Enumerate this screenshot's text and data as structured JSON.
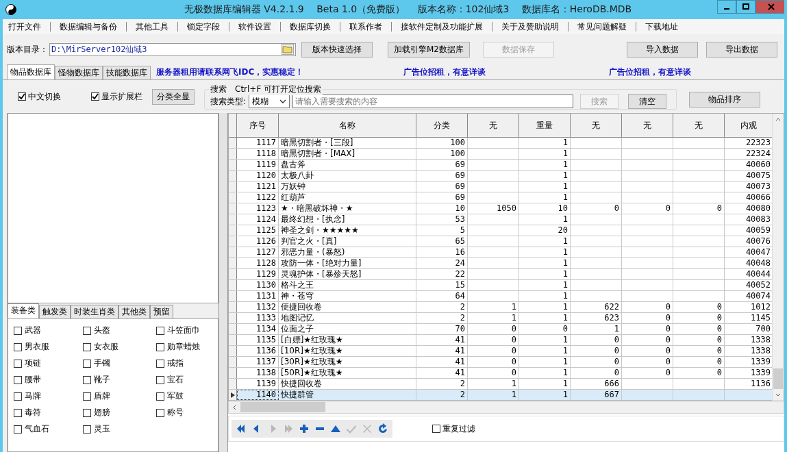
{
  "window": {
    "title": "无极数据库编辑器 V4.2.1.9　 Beta 1.0（免费版）　 版本名称：102仙域3　 数据库名：HeroDB.MDB"
  },
  "menu": [
    "打开文件",
    "数据编辑与备份",
    "其他工具",
    "锁定字段",
    "软件设置",
    "数据库切换",
    "联系作者",
    "接软件定制及功能扩展",
    "关于及赞助说明",
    "常见问题解疑",
    "下载地址"
  ],
  "toolbar": {
    "dir_label": "版本目录：",
    "dir_value": "D:\\MirServer102仙域3",
    "buttons": [
      {
        "label": "版本快速选择",
        "disabled": false
      },
      {
        "label": "加载引擎M2数据库",
        "disabled": false
      },
      {
        "label": "数据保存",
        "disabled": true
      },
      {
        "label": "导入数据",
        "disabled": false
      },
      {
        "label": "导出数据",
        "disabled": false
      }
    ]
  },
  "tabs": [
    {
      "label": "物品数据库",
      "selected": true
    },
    {
      "label": "怪物数据库",
      "selected": false
    },
    {
      "label": "技能数据库",
      "selected": false
    }
  ],
  "ads": [
    "服务器租用请联系网飞IDC，实惠稳定！",
    "广告位招租，有意详谈",
    "广告位招租，有意详谈"
  ],
  "options": [
    {
      "label": "中文切换",
      "checked": true
    },
    {
      "label": "显示扩展栏",
      "checked": true
    }
  ],
  "show_all_button": "分类全显",
  "search": {
    "title": "搜索　Ctrl+F 可打开定位搜索",
    "type_label": "搜索类型:",
    "type_value": "模糊",
    "placeholder": "请输入需要搜索的内容",
    "search_button": {
      "label": "搜索",
      "disabled": true
    },
    "clear_button": "清空"
  },
  "sort_button": "物品排序",
  "category_tabs": [
    {
      "label": "装备类",
      "selected": true
    },
    {
      "label": "触发类",
      "selected": false
    },
    {
      "label": "时装生肖类",
      "selected": false
    },
    {
      "label": "其他类",
      "selected": false
    },
    {
      "label": "预留",
      "selected": false
    }
  ],
  "categories": [
    {
      "label": "武器",
      "checked": false
    },
    {
      "label": "头盔",
      "checked": false
    },
    {
      "label": "斗笠面巾",
      "checked": false
    },
    {
      "label": "男衣服",
      "checked": false
    },
    {
      "label": "女衣服",
      "checked": false
    },
    {
      "label": "勋章蜡烛",
      "checked": false
    },
    {
      "label": "项链",
      "checked": false
    },
    {
      "label": "手镯",
      "checked": false
    },
    {
      "label": "戒指",
      "checked": false
    },
    {
      "label": "腰带",
      "checked": false
    },
    {
      "label": "靴子",
      "checked": false
    },
    {
      "label": "宝石",
      "checked": false
    },
    {
      "label": "马牌",
      "checked": false
    },
    {
      "label": "盾牌",
      "checked": false
    },
    {
      "label": "军鼓",
      "checked": false
    },
    {
      "label": "毒符",
      "checked": false
    },
    {
      "label": "翅膀",
      "checked": false
    },
    {
      "label": "称号",
      "checked": false
    },
    {
      "label": "气血石",
      "checked": false
    },
    {
      "label": "灵玉",
      "checked": false
    }
  ],
  "table": {
    "columns": [
      "序号",
      "名称",
      "分类",
      "无",
      "重量",
      "无",
      "无",
      "无",
      "内观"
    ],
    "rows": [
      {
        "cells": [
          "1117",
          "暗黑切割者・[三段]",
          "100",
          "",
          "1",
          "",
          "",
          "",
          "22323"
        ],
        "selected": false
      },
      {
        "cells": [
          "1118",
          "暗黑切割者・[MAX]",
          "100",
          "",
          "1",
          "",
          "",
          "",
          "22324"
        ],
        "selected": false
      },
      {
        "cells": [
          "1119",
          "盘古斧",
          "69",
          "",
          "1",
          "",
          "",
          "",
          "40060"
        ],
        "selected": false
      },
      {
        "cells": [
          "1120",
          "太极八卦",
          "69",
          "",
          "1",
          "",
          "",
          "",
          "40075"
        ],
        "selected": false
      },
      {
        "cells": [
          "1121",
          "万妖钟",
          "69",
          "",
          "1",
          "",
          "",
          "",
          "40073"
        ],
        "selected": false
      },
      {
        "cells": [
          "1122",
          "红葫芦",
          "69",
          "",
          "1",
          "",
          "",
          "",
          "40066"
        ],
        "selected": false
      },
      {
        "cells": [
          "1123",
          "★・暗黑破坏神・★",
          "10",
          "1050",
          "10",
          "0",
          "0",
          "0",
          "40080"
        ],
        "selected": false
      },
      {
        "cells": [
          "1124",
          "最终幻想・[执念]",
          "53",
          "",
          "1",
          "",
          "",
          "",
          "40083"
        ],
        "selected": false
      },
      {
        "cells": [
          "1125",
          "神圣之剑・★★★★★",
          "5",
          "",
          "20",
          "",
          "",
          "",
          "40059"
        ],
        "selected": false
      },
      {
        "cells": [
          "1126",
          "判官之火・[真]",
          "65",
          "",
          "1",
          "",
          "",
          "",
          "40076"
        ],
        "selected": false
      },
      {
        "cells": [
          "1127",
          "邪恶力量・(暴怒)",
          "16",
          "",
          "1",
          "",
          "",
          "",
          "40047"
        ],
        "selected": false
      },
      {
        "cells": [
          "1128",
          "攻防一体・[绝对力量]",
          "24",
          "",
          "1",
          "",
          "",
          "",
          "40048"
        ],
        "selected": false
      },
      {
        "cells": [
          "1129",
          "灵魂护体・[暴殄天怒]",
          "22",
          "",
          "1",
          "",
          "",
          "",
          "40044"
        ],
        "selected": false
      },
      {
        "cells": [
          "1130",
          "格斗之王",
          "15",
          "",
          "1",
          "",
          "",
          "",
          "40052"
        ],
        "selected": false
      },
      {
        "cells": [
          "1131",
          "神・苍穹",
          "64",
          "",
          "1",
          "",
          "",
          "",
          "40074"
        ],
        "selected": false
      },
      {
        "cells": [
          "1132",
          "便捷回收卷",
          "2",
          "1",
          "1",
          "622",
          "0",
          "0",
          "1012"
        ],
        "selected": false
      },
      {
        "cells": [
          "1133",
          "地图记忆",
          "2",
          "1",
          "1",
          "623",
          "0",
          "0",
          "1145"
        ],
        "selected": false
      },
      {
        "cells": [
          "1134",
          "位面之子",
          "70",
          "0",
          "0",
          "1",
          "0",
          "0",
          "700"
        ],
        "selected": false
      },
      {
        "cells": [
          "1135",
          "[白嫖]★红玫瑰★",
          "41",
          "0",
          "1",
          "0",
          "0",
          "0",
          "1338"
        ],
        "selected": false
      },
      {
        "cells": [
          "1136",
          "[10R]★红玫瑰★",
          "41",
          "0",
          "1",
          "0",
          "0",
          "0",
          "1338"
        ],
        "selected": false
      },
      {
        "cells": [
          "1137",
          "[30R]★红玫瑰★",
          "41",
          "0",
          "1",
          "0",
          "0",
          "0",
          "1339"
        ],
        "selected": false
      },
      {
        "cells": [
          "1138",
          "[50R]★红玫瑰★",
          "41",
          "0",
          "1",
          "0",
          "0",
          "0",
          "1339"
        ],
        "selected": false
      },
      {
        "cells": [
          "1139",
          "快捷回收卷",
          "2",
          "1",
          "1",
          "666",
          "",
          "",
          "1136"
        ],
        "selected": false
      },
      {
        "cells": [
          "1140",
          "快捷群管",
          "2",
          "1",
          "1",
          "667",
          "",
          "",
          ""
        ],
        "selected": true
      }
    ]
  },
  "nav_buttons": [
    {
      "kind": "first",
      "disabled": false
    },
    {
      "kind": "prev",
      "disabled": false
    },
    {
      "kind": "next",
      "disabled": true
    },
    {
      "kind": "last",
      "disabled": true
    },
    {
      "kind": "add",
      "disabled": false
    },
    {
      "kind": "remove",
      "disabled": false
    },
    {
      "kind": "up",
      "disabled": false
    },
    {
      "kind": "confirm",
      "disabled": true
    },
    {
      "kind": "cancel",
      "disabled": true
    },
    {
      "kind": "refresh",
      "disabled": false
    }
  ],
  "duplicate_filter": {
    "label": "重复过滤",
    "checked": false
  }
}
